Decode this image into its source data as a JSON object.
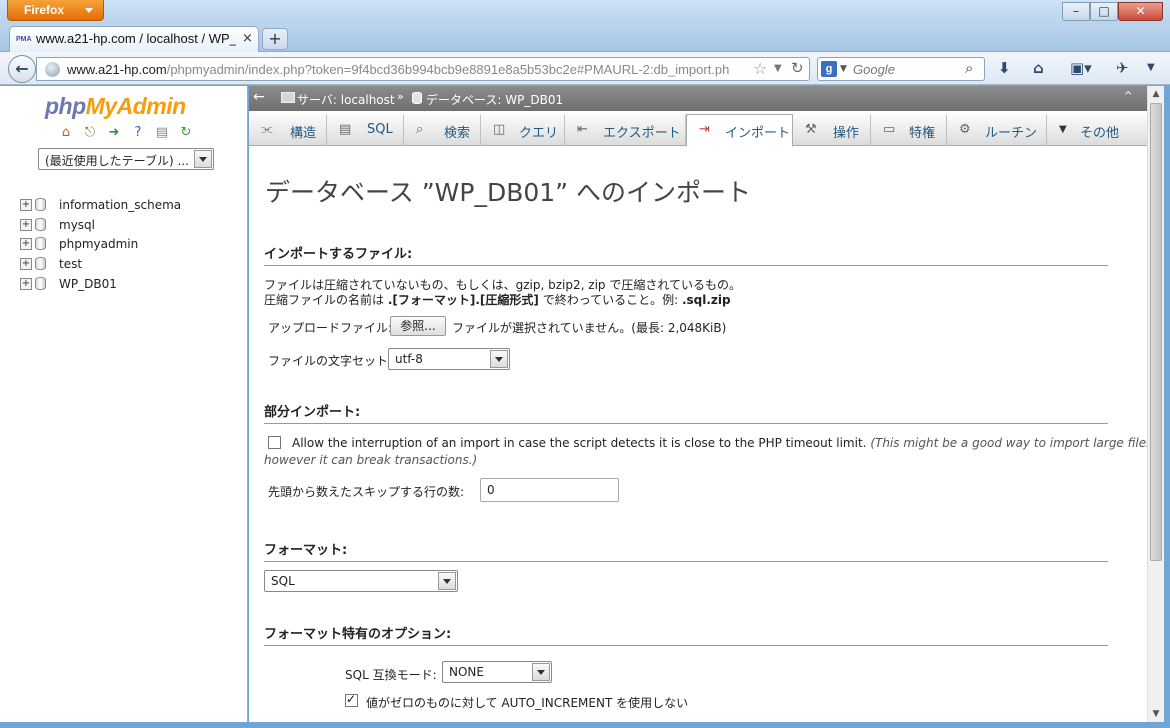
{
  "browser": {
    "menu_button": "Firefox",
    "tab_title": "www.a21-hp.com / localhost / WP_...",
    "tab_close": "×",
    "new_tab": "+",
    "favicon_text": "PMA",
    "url_host": "www.a21-hp.com",
    "url_rest": "/phpmyadmin/index.php?token=9f4bcd36b994bcb9e8891e8a5b53bc2e#PMAURL-2:db_import.ph",
    "search_placeholder": "Google",
    "search_engine": "g"
  },
  "nav": {
    "logo_part1": "php",
    "logo_part2": "MyAdmin",
    "recent_tables": "(最近使用したテーブル) ...",
    "databases": [
      "information_schema",
      "mysql",
      "phpmyadmin",
      "test",
      "WP_DB01"
    ]
  },
  "breadcrumb": {
    "server": "サーバ: localhost",
    "separator": "»",
    "database": "データベース: WP_DB01"
  },
  "menu": {
    "tabs": [
      {
        "label": "構造",
        "icon": "structure-icon"
      },
      {
        "label": "SQL",
        "icon": "sql-icon"
      },
      {
        "label": "検索",
        "icon": "search-icon"
      },
      {
        "label": "クエリ",
        "icon": "query-icon"
      },
      {
        "label": "エクスポート",
        "icon": "export-icon"
      },
      {
        "label": "インポート",
        "icon": "import-icon"
      },
      {
        "label": "操作",
        "icon": "wrench-icon"
      },
      {
        "label": "特権",
        "icon": "privileges-icon"
      },
      {
        "label": "ルーチン",
        "icon": "routines-icon"
      },
      {
        "label": "その他",
        "icon": "more-icon"
      }
    ],
    "active_tab": "インポート"
  },
  "page": {
    "title": "データベース ”WP_DB01” へのインポート"
  },
  "file_section": {
    "heading": "インポートするファイル:",
    "desc1": "ファイルは圧縮されていないもの、もしくは、gzip, bzip2, zip で圧縮されているもの。",
    "desc2_prefix": "圧縮ファイルの名前は ",
    "desc2_bold": ".[フォーマット].[圧縮形式]",
    "desc2_mid": " で終わっていること。例: ",
    "desc2_example": ".sql.zip",
    "upload_label": "アップロードファイル:",
    "browse_button": "参照...",
    "upload_status": "ファイルが選択されていません。(最長: 2,048KiB)",
    "charset_label": "ファイルの文字セット:",
    "charset_value": "utf-8"
  },
  "partial_section": {
    "heading": "部分インポート:",
    "interrupt_checked": false,
    "interrupt_text": "Allow the interruption of an import in case the script detects it is close to the PHP timeout limit.",
    "interrupt_note1": "(This might be a good way to import large files,",
    "interrupt_note2": "however it can break transactions.)",
    "skip_label": "先頭から数えたスキップする行の数:",
    "skip_value": "0"
  },
  "format_section": {
    "heading": "フォーマット:",
    "format_value": "SQL"
  },
  "format_options": {
    "heading": "フォーマット特有のオプション:",
    "compat_label": "SQL 互換モード:",
    "compat_value": "NONE",
    "no_auto_checked": true,
    "no_auto_text": "値がゼロのものに対して AUTO_INCREMENT を使用しない"
  }
}
